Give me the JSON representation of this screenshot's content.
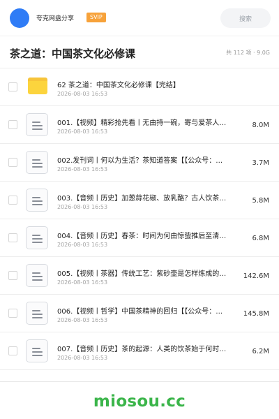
{
  "header": {
    "share_name": "夸克网盘分享",
    "badge": "SVIP",
    "search_placeholder": "搜索"
  },
  "folder": {
    "title": "茶之道：中国茶文化必修课",
    "summary": "共 112 项 · 9.0G"
  },
  "items": [
    {
      "type": "folder",
      "name": "62 茶之道：中国茶文化必修课【完结】",
      "date": "2026-08-03 16:53",
      "size": ""
    },
    {
      "type": "file",
      "name": "001.【视频】精彩抢先看丨无由持一碗，寄与爱茶人…",
      "date": "2026-08-03 16:53",
      "size": "8.0M"
    },
    {
      "type": "file",
      "name": "002.发刊词丨何以为生活？茶知道答案【【公众号：…",
      "date": "2026-08-03 16:53",
      "size": "3.7M"
    },
    {
      "type": "file",
      "name": "003.【音频丨历史】加葱蒜花椒、放乳酪？古人饮茶…",
      "date": "2026-08-03 16:53",
      "size": "5.8M"
    },
    {
      "type": "file",
      "name": "004.【音频丨历史】春茶：时间为何由惊蛰推后至清…",
      "date": "2026-08-03 16:53",
      "size": "6.8M"
    },
    {
      "type": "file",
      "name": "005.【视频丨茶器】传统工艺：紫砂壶是怎样炼成的…",
      "date": "2026-08-03 16:53",
      "size": "142.6M"
    },
    {
      "type": "file",
      "name": "006.【视频丨哲学】中国茶精神的回归【【公众号：…",
      "date": "2026-08-03 16:53",
      "size": "145.8M"
    },
    {
      "type": "file",
      "name": "007.【音频丨历史】茶的起源：人类的饮茶始于何时…",
      "date": "2026-08-03 16:53",
      "size": "6.2M"
    }
  ],
  "watermark": "miosou.cc",
  "colors": {
    "avatar": "#2f7cf6",
    "badge": "#f7a23a",
    "folder": "#fcd43d",
    "watermark": "#3bb54a"
  }
}
